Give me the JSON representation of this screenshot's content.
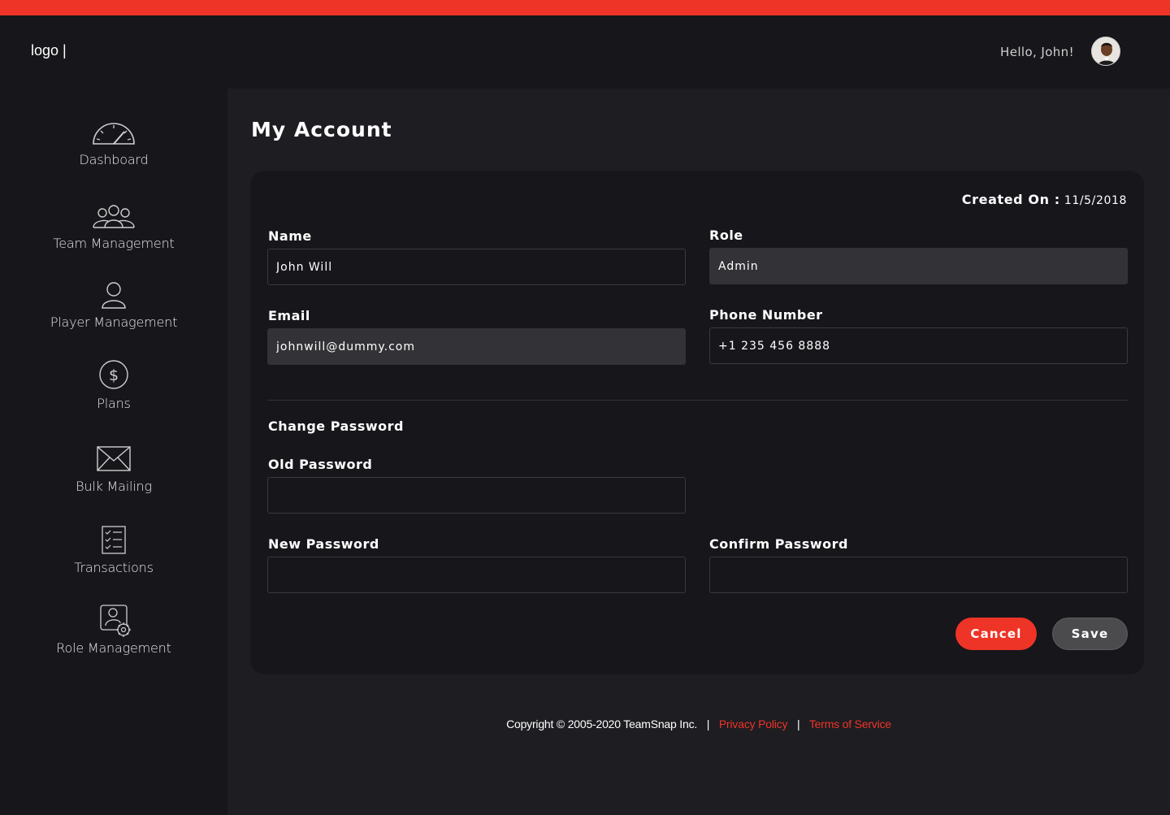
{
  "header": {
    "logo": "logo |",
    "greeting": "Hello, John!"
  },
  "sidebar": {
    "items": [
      {
        "label": "Dashboard",
        "icon": "speedometer-icon"
      },
      {
        "label": "Team Management",
        "icon": "team-icon"
      },
      {
        "label": "Player Management",
        "icon": "user-icon"
      },
      {
        "label": "Plans",
        "icon": "dollar-icon"
      },
      {
        "label": "Bulk Mailing",
        "icon": "envelope-icon"
      },
      {
        "label": "Transactions",
        "icon": "checklist-icon"
      },
      {
        "label": "Role Management",
        "icon": "user-settings-icon"
      }
    ]
  },
  "main": {
    "title": "My Account",
    "created_label": "Created On :",
    "created_value": "11/5/2018",
    "fields": {
      "name_label": "Name",
      "name_value": "John Will",
      "role_label": "Role",
      "role_value": "Admin",
      "email_label": "Email",
      "email_value": "johnwill@dummy.com",
      "phone_label": "Phone Number",
      "phone_value": "+1 235 456 8888"
    },
    "password": {
      "section_title": "Change Password",
      "old_label": "Old Password",
      "new_label": "New Password",
      "confirm_label": "Confirm Password"
    },
    "buttons": {
      "cancel": "Cancel",
      "save": "Save"
    }
  },
  "footer": {
    "copyright": "Copyright © 2005-2020 TeamSnap Inc.",
    "separator": "|",
    "privacy": "Privacy Policy",
    "terms": "Terms of Service"
  },
  "colors": {
    "accent": "#ee3427",
    "background": "#1e1d22",
    "panel": "#17161b",
    "readonly_field": "#333236"
  }
}
